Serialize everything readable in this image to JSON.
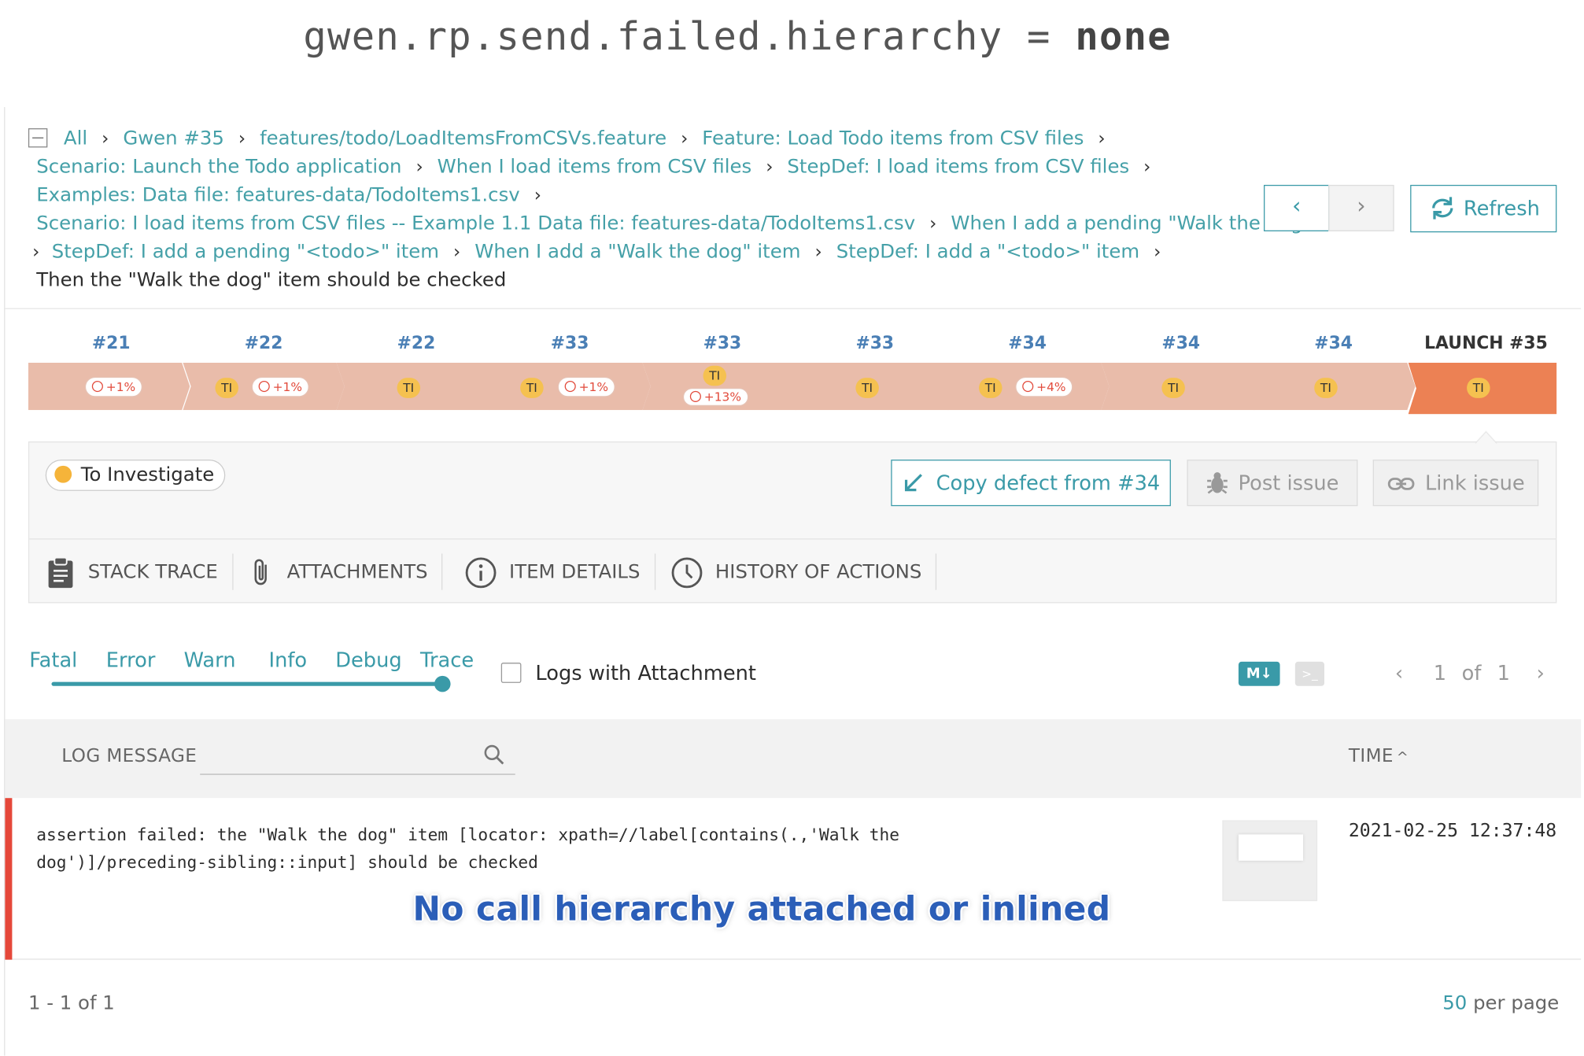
{
  "config_title": {
    "key": "gwen.rp.send.failed.hierarchy",
    "eq": " = ",
    "value": "none"
  },
  "breadcrumb": {
    "items": [
      "All",
      "Gwen #35",
      "features/todo/LoadItemsFromCSVs.feature",
      "Feature: Load Todo items from CSV files",
      "Scenario: Launch the Todo application",
      "When I load items from CSV files",
      "StepDef: I load items from CSV files",
      "Examples: Data file: features-data/TodoItems1.csv",
      "Scenario: I load items from CSV files -- Example 1.1 Data file: features-data/TodoItems1.csv",
      "When I add a pending \"Walk the dog\" item",
      "StepDef: I add a pending \"<todo>\" item",
      "When I add a \"Walk the dog\" item",
      "StepDef: I add a \"<todo>\" item"
    ],
    "current": "Then the \"Walk the dog\" item should be checked"
  },
  "nav": {
    "prev_icon": "chevron-left-icon",
    "next_icon": "chevron-right-icon",
    "refresh_label": "Refresh"
  },
  "history": {
    "items": [
      {
        "label": "#21",
        "ti": "",
        "pct": "+1%"
      },
      {
        "label": "#22",
        "ti": "TI",
        "pct": "+1%"
      },
      {
        "label": "#22",
        "ti": "TI",
        "pct": ""
      },
      {
        "label": "#33",
        "ti": "TI",
        "pct": "+1%"
      },
      {
        "label": "#33",
        "ti": "TI",
        "pct": "+13%"
      },
      {
        "label": "#33",
        "ti": "TI",
        "pct": ""
      },
      {
        "label": "#34",
        "ti": "TI",
        "pct": "+4%"
      },
      {
        "label": "#34",
        "ti": "TI",
        "pct": ""
      },
      {
        "label": "#34",
        "ti": "TI",
        "pct": ""
      },
      {
        "label": "LAUNCH #35",
        "ti": "TI",
        "pct": ""
      }
    ],
    "colors": {
      "segment": "#e9bcaa",
      "current": "#ec8154",
      "ti_badge": "#f5c150"
    }
  },
  "defect": {
    "status": "To Investigate",
    "copy_label": "Copy defect from #34",
    "post_label": "Post issue",
    "link_label": "Link issue"
  },
  "tabs": {
    "stack_trace": "STACK TRACE",
    "attachments": "ATTACHMENTS",
    "item_details": "ITEM DETAILS",
    "history": "HISTORY OF ACTIONS"
  },
  "log_levels": [
    "Fatal",
    "Error",
    "Warn",
    "Info",
    "Debug",
    "Trace"
  ],
  "logs_with_attachment": "Logs with Attachment",
  "markdown_label": "M↓",
  "console_label": ">_",
  "pagination": {
    "current": "1",
    "of": "of",
    "total": "1"
  },
  "table": {
    "col_message": "LOG MESSAGE",
    "col_time": "TIME",
    "sort_icon": "^",
    "rows": [
      {
        "message_line1": "assertion failed: the \"Walk the dog\" item [locator: xpath=//label[contains(.,'Walk the",
        "message_line2": "dog')]/preceding-sibling::input] should be checked",
        "time": "2021-02-25 12:37:48"
      }
    ]
  },
  "annotation": "No call hierarchy attached or inlined",
  "footer": {
    "range": "1 - 1 of 1",
    "per_page_count": "50",
    "per_page_label": " per page"
  },
  "accent_color": "#3a9aa8"
}
